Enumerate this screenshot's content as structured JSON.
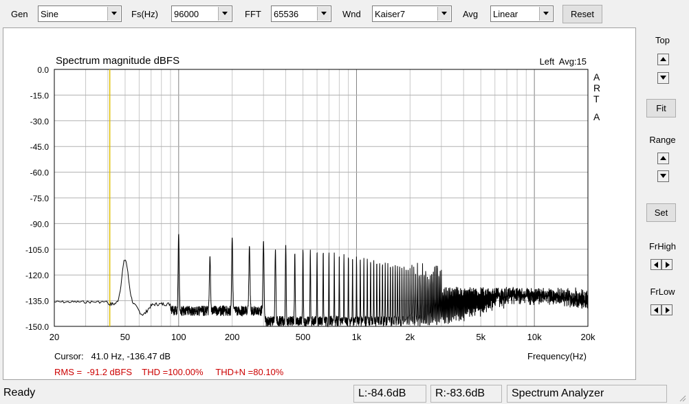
{
  "toolbar": {
    "gen_label": "Gen",
    "gen_value": "Sine",
    "fs_label": "Fs(Hz)",
    "fs_value": "96000",
    "fft_label": "FFT",
    "fft_value": "65536",
    "wnd_label": "Wnd",
    "wnd_value": "Kaiser7",
    "avg_label": "Avg",
    "avg_value": "Linear",
    "reset_label": "Reset"
  },
  "side": {
    "top_label": "Top",
    "fit_label": "Fit",
    "range_label": "Range",
    "set_label": "Set",
    "frhigh_label": "FrHigh",
    "frlow_label": "FrLow"
  },
  "plot": {
    "title": "Spectrum magnitude dBFS",
    "channel_avg": "Left  Avg:15",
    "watermark": [
      "A",
      "R",
      "T",
      "A"
    ],
    "cursor_text": "Cursor:   41.0 Hz, -136.47 dB",
    "xlabel": "Frequency(Hz)",
    "rms_text": "RMS =  -91.2 dBFS    THD =100.00%     THD+N =80.10%",
    "colors": {
      "trace": "#000000",
      "cursor": "#e0c000",
      "grid": "#c0c0c0",
      "stats": "#cc0000"
    }
  },
  "status": {
    "ready": "Ready",
    "left": "L:-84.6dB",
    "right": "R:-83.6dB",
    "mode": "Spectrum Analyzer"
  },
  "chart_data": {
    "type": "line",
    "xscale": "log",
    "xlim": [
      20,
      20000
    ],
    "ylim": [
      -150,
      0
    ],
    "yticks": [
      "0.0",
      "-15.0",
      "-30.0",
      "-45.0",
      "-60.0",
      "-75.0",
      "-90.0",
      "-105.0",
      "-120.0",
      "-135.0",
      "-150.0"
    ],
    "xticks": [
      "20",
      "50",
      "100",
      "200",
      "500",
      "1k",
      "2k",
      "5k",
      "10k",
      "20k"
    ],
    "xtick_values": [
      20,
      50,
      100,
      200,
      500,
      1000,
      2000,
      5000,
      10000,
      20000
    ],
    "cursor_x": 41,
    "noise_floor_db": -135,
    "peaks": [
      {
        "x": 50,
        "y": -110
      },
      {
        "x": 100,
        "y": -96
      },
      {
        "x": 150,
        "y": -109
      },
      {
        "x": 200,
        "y": -98
      },
      {
        "x": 250,
        "y": -103
      },
      {
        "x": 300,
        "y": -100
      },
      {
        "x": 350,
        "y": -105
      },
      {
        "x": 400,
        "y": -102
      },
      {
        "x": 450,
        "y": -107
      },
      {
        "x": 500,
        "y": -105
      },
      {
        "x": 700,
        "y": -106
      },
      {
        "x": 1000,
        "y": -109
      },
      {
        "x": 1500,
        "y": -113
      },
      {
        "x": 2000,
        "y": -116
      },
      {
        "x": 3000,
        "y": -119
      },
      {
        "x": 5000,
        "y": -123
      },
      {
        "x": 10000,
        "y": -128
      },
      {
        "x": 20000,
        "y": -134
      }
    ]
  }
}
